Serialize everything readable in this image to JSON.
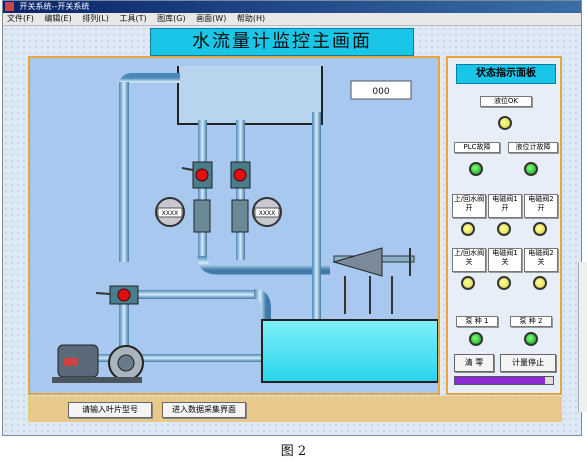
{
  "window": {
    "title": "开关系统--开关系统",
    "menu": [
      "文件(F)",
      "编辑(E)",
      "排列(L)",
      "工具(T)",
      "图库(G)",
      "画面(W)",
      "帮助(H)"
    ]
  },
  "main": {
    "title": "水流量计监控主画面",
    "tank_level_value": "000",
    "flowmeter_left_value": "XXXX",
    "flowmeter_right_value": "XXXX"
  },
  "status_panel": {
    "title": "状态指示面板",
    "liquid_level_label": "液位OK",
    "plc_fault_label": "PLC故障",
    "level_meter_fault_label": "液位计故障",
    "valve_labels_row1": [
      "上/回水阀开",
      "电磁阀1开",
      "电磁阀2开"
    ],
    "valve_labels_row2": [
      "上/回水阀关",
      "电磁阀1关",
      "电磁阀2关"
    ],
    "pump1_label": "泵 种 1",
    "pump2_label": "泵 种 2",
    "clear_button": "清 零",
    "stop_button": "计量停止",
    "progress": 0.92,
    "colors": {
      "lamp_yellow": "#e8e060",
      "lamp_green": "#1ec81e",
      "progress": "#8a2bd6"
    }
  },
  "bottom": {
    "button_left": "请输入叶片型号",
    "button_right": "进入数据采集界面"
  },
  "caption": "图 2"
}
